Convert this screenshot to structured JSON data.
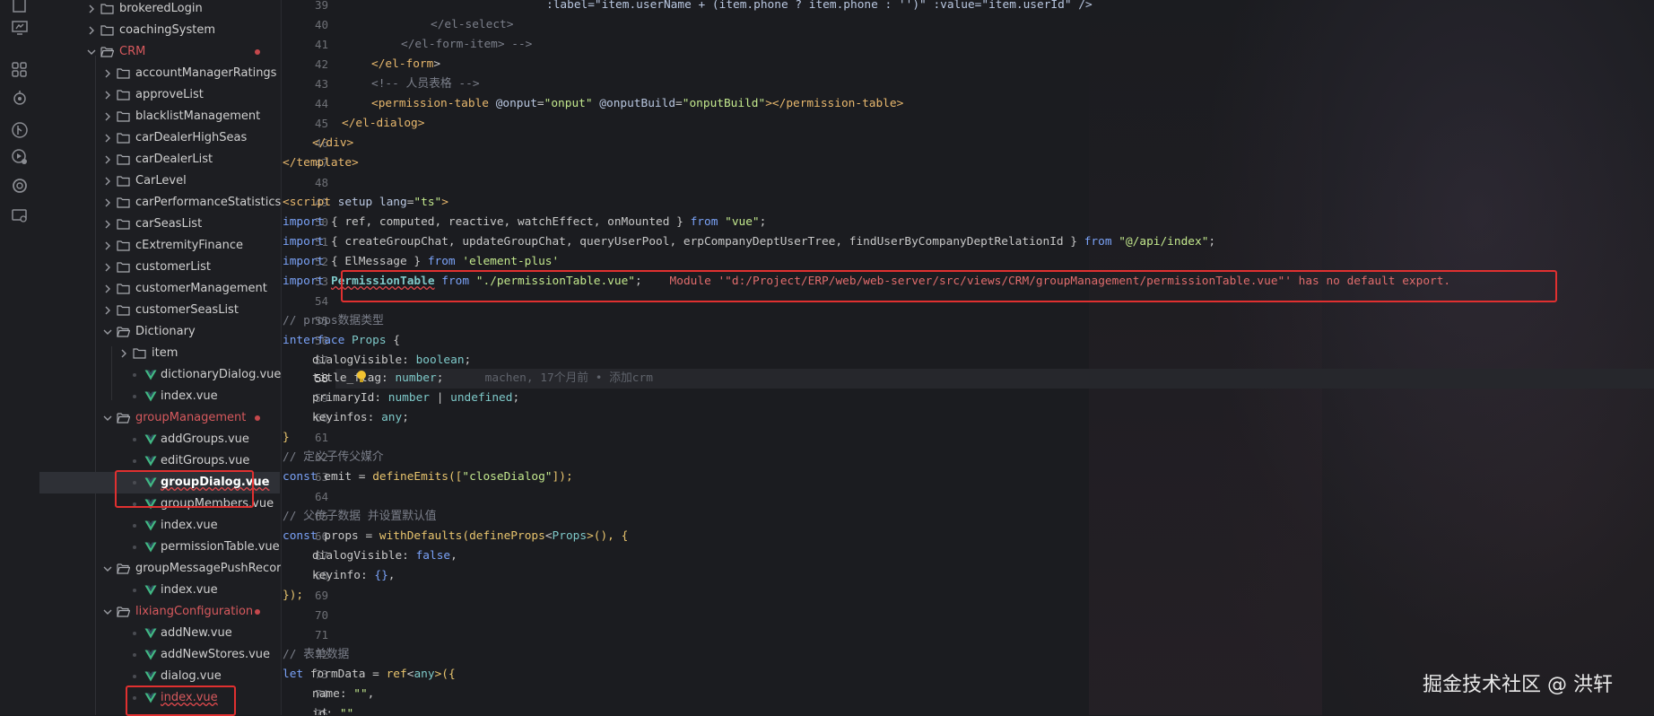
{
  "explorer": {
    "items": [
      {
        "label": "brokeredLogin",
        "kind": "folder"
      },
      {
        "label": "coachingSystem",
        "kind": "folder"
      },
      {
        "label": "CRM",
        "kind": "folder-open"
      },
      {
        "label": "accountManagerRatings",
        "kind": "folder"
      },
      {
        "label": "approveList",
        "kind": "folder"
      },
      {
        "label": "blacklistManagement",
        "kind": "folder"
      },
      {
        "label": "carDealerHighSeas",
        "kind": "folder"
      },
      {
        "label": "carDealerList",
        "kind": "folder"
      },
      {
        "label": "CarLevel",
        "kind": "folder"
      },
      {
        "label": "carPerformanceStatistics",
        "kind": "folder"
      },
      {
        "label": "carSeasList",
        "kind": "folder"
      },
      {
        "label": "cExtremityFinance",
        "kind": "folder"
      },
      {
        "label": "customerList",
        "kind": "folder"
      },
      {
        "label": "customerManagement",
        "kind": "folder"
      },
      {
        "label": "customerSeasList",
        "kind": "folder"
      },
      {
        "label": "Dictionary",
        "kind": "folder-open"
      },
      {
        "label": "item",
        "kind": "folder"
      },
      {
        "label": "dictionaryDialog.vue",
        "kind": "vue"
      },
      {
        "label": "index.vue",
        "kind": "vue"
      },
      {
        "label": "groupManagement",
        "kind": "folder-open"
      },
      {
        "label": "addGroups.vue",
        "kind": "vue"
      },
      {
        "label": "editGroups.vue",
        "kind": "vue"
      },
      {
        "label": "groupDialog.vue",
        "kind": "vue"
      },
      {
        "label": "groupMembers.vue",
        "kind": "vue"
      },
      {
        "label": "index.vue",
        "kind": "vue"
      },
      {
        "label": "permissionTable.vue",
        "kind": "vue"
      },
      {
        "label": "groupMessagePushRecor...",
        "kind": "folder-open"
      },
      {
        "label": "index.vue",
        "kind": "vue"
      },
      {
        "label": "lixiangConfiguration",
        "kind": "folder-open"
      },
      {
        "label": "addNew.vue",
        "kind": "vue"
      },
      {
        "label": "addNewStores.vue",
        "kind": "vue"
      },
      {
        "label": "dialog.vue",
        "kind": "vue"
      },
      {
        "label": "index.vue",
        "kind": "vue"
      }
    ]
  },
  "editor": {
    "line_numbers": [
      "39",
      "40",
      "41",
      "42",
      "43",
      "44",
      "45",
      "46",
      "47",
      "48",
      "49",
      "50",
      "51",
      "52",
      "53",
      "54",
      "55",
      "56",
      "57",
      "58",
      "59",
      "60",
      "61",
      "62",
      "63",
      "64",
      "65",
      "66",
      "67",
      "68",
      "69",
      "70",
      "71",
      "72",
      "73",
      "74",
      "75"
    ],
    "current_line": "58",
    "lines": {
      "l39": ":label=\"item.userName + (item.phone ? item.phone : '')\" :value=\"item.userId\" />",
      "l40": "</el-select>",
      "l41": "</el-form-item> -->",
      "l42a": "</el-form",
      "l42b": ">",
      "l43": "<!-- 人员表格 -->",
      "l44a": "<permission-table",
      "l44b": " @onput",
      "l44c": "=",
      "l44d": "\"onput\"",
      "l44e": " @onputBuild",
      "l44f": "=",
      "l44g": "\"onputBuild\"",
      "l44h": "></permission-table>",
      "l45": "</el-dialog>",
      "l46": "</div>",
      "l47": "</template>",
      "l49a": "<script",
      "l49b": " setup",
      "l49c": " lang",
      "l49d": "=",
      "l49e": "\"ts\"",
      "l49f": ">",
      "l50a": "import",
      "l50b": " { ref, computed, reactive, watchEffect, onMounted } ",
      "l50c": "from",
      "l50d": " \"vue\"",
      "l50e": ";",
      "l51a": "import",
      "l51b": " { createGroupChat, updateGroupChat, queryUserPool, erpCompanyDeptUserTree, findUserByCompanyDeptRelationId } ",
      "l51c": "from",
      "l51d": " \"@/api/index\"",
      "l51e": ";",
      "l52a": "import",
      "l52b": " { ElMessage } ",
      "l52c": "from",
      "l52d": " 'element-plus'",
      "l53a": "import",
      "l53b": "PermissionTable",
      "l53c": "from",
      "l53d": "\"./permissionTable.vue\"",
      "l53e": ";",
      "l53err": "Module '\"d:/Project/ERP/web/web-server/src/views/CRM/groupManagement/permissionTable.vue\"' has no default export.",
      "l55": "// props数据类型",
      "l56a": "interface",
      "l56b": " Props",
      "l56c": " {",
      "l57a": "dialogVisible",
      "l57b": ": ",
      "l57c": "boolean",
      "l57d": ";",
      "l58a": "title_flag",
      "l58b": ": ",
      "l58c": "number",
      "l58d": ";",
      "l58ghost": "machen, 17个月前 • 添加crm",
      "l59a": "primaryId",
      "l59b": ": ",
      "l59c": "number",
      "l59d": " | ",
      "l59e": "undefined",
      "l59f": ";",
      "l60a": "keyinfos",
      "l60b": ": ",
      "l60c": "any",
      "l60d": ";",
      "l61": "}",
      "l62": "// 定义子传父媒介",
      "l63a": "const",
      "l63b": " emit",
      "l63c": " = ",
      "l63d": "defineEmits",
      "l63e": "([",
      "l63f": "\"closeDialog\"",
      "l63g": "]);",
      "l65": "// 父传子数据 并设置默认值",
      "l66a": "const",
      "l66b": " props",
      "l66c": " = ",
      "l66d": "withDefaults",
      "l66e": "(",
      "l66f": "defineProps",
      "l66g": "<",
      "l66h": "Props",
      "l66i": ">(), {",
      "l67a": "dialogVisible",
      "l67b": ": ",
      "l67c": "false",
      "l67d": ",",
      "l68a": "keyinfo",
      "l68b": ": ",
      "l68c": "{}",
      "l68d": ",",
      "l69": "});",
      "l72": "// 表单数据",
      "l73a": "let",
      "l73b": " formData",
      "l73c": " = ",
      "l73d": "ref",
      "l73e": "<",
      "l73f": "any",
      "l73g": ">({",
      "l74a": "name",
      "l74b": ": ",
      "l74c": "\"\"",
      "l74d": ",",
      "l75a": "id",
      "l75b": ": ",
      "l75c": "\"\""
    }
  },
  "watermark": "掘金技术社区 @ 洪轩",
  "colors": {
    "error_box": "#e03030",
    "modified_folder": "#d6595d"
  }
}
